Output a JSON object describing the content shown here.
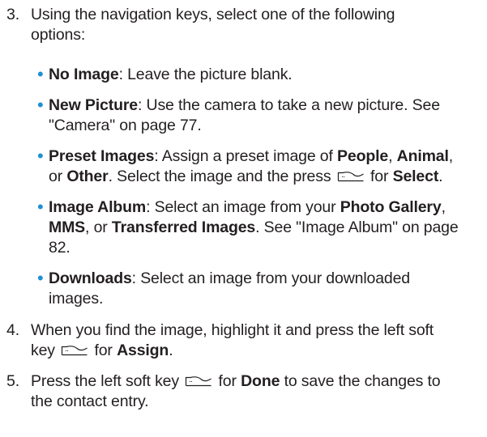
{
  "steps": [
    {
      "number": "3.",
      "line1": "Using the navigation keys, select one of the following",
      "line2": "options:"
    },
    {
      "number": "4.",
      "line1": "When you find the image, highlight it and press the left soft",
      "line2_pre": "key",
      "line2_post": "for",
      "line2_bold": "Assign",
      "line2_end": "."
    },
    {
      "number": "5.",
      "line1_pre": "Press the left soft key",
      "line1_mid": "for",
      "line1_bold": "Done",
      "line1_post": "to save the changes to",
      "line2": "the contact entry."
    }
  ],
  "options": [
    {
      "term": "No Image",
      "text": ": Leave the picture blank."
    },
    {
      "term": "New Picture",
      "text_line1": ": Use the camera to take a new picture. See",
      "text_line2": "\"Camera\" on page 77."
    },
    {
      "term": "Preset Images",
      "t1": ": Assign a preset image of ",
      "b1": "People",
      "t2": ", ",
      "b2": "Animal",
      "t3": ",",
      "t4": "or ",
      "b3": "Other",
      "t5": ". Select the image and the press",
      "t6": "for",
      "b4": "Select",
      "t7": "."
    },
    {
      "term": "Image Album",
      "t1": ": Select an image from your ",
      "b1": "Photo Gallery",
      "t2": ",",
      "b2": "MMS",
      "t3": ", or ",
      "b3": "Transferred Images",
      "t4": ". See \"Image Album\" on page",
      "t5": "82."
    },
    {
      "term": "Downloads",
      "t1": ": Select an image from your downloaded",
      "t2": "images."
    }
  ],
  "bullet_symbol": "•",
  "icons": {
    "soft_key": "left-soft-key-icon"
  },
  "colors": {
    "text": "#231f20",
    "bullet": "#1f8fd6"
  }
}
